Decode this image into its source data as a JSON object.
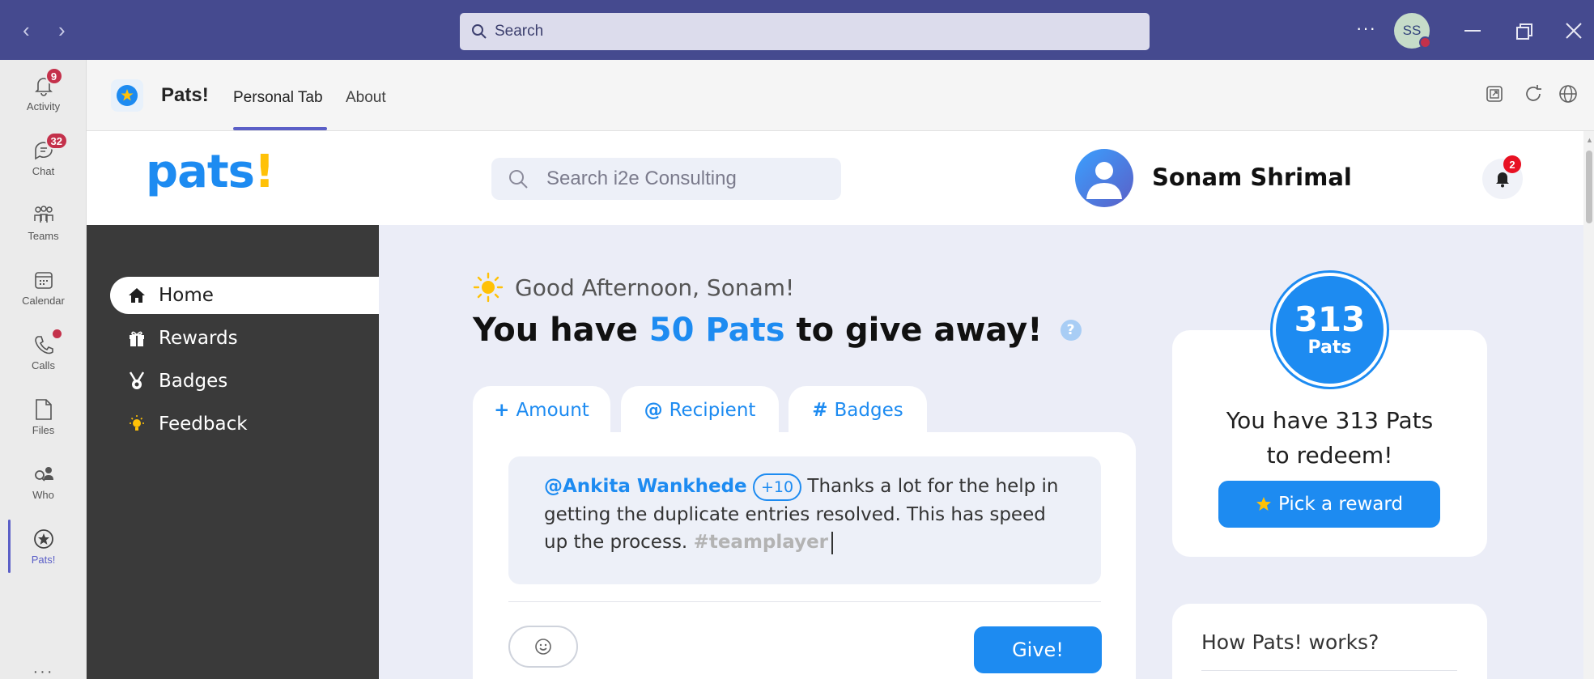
{
  "titlebar": {
    "search_placeholder": "Search",
    "more_label": "···",
    "user_initials": "SS"
  },
  "rail": {
    "items": [
      {
        "label": "Activity",
        "icon": "bell-icon",
        "badge": "9"
      },
      {
        "label": "Chat",
        "icon": "chat-icon",
        "badge": "32"
      },
      {
        "label": "Teams",
        "icon": "teams-icon"
      },
      {
        "label": "Calendar",
        "icon": "calendar-icon"
      },
      {
        "label": "Calls",
        "icon": "phone-icon"
      },
      {
        "label": "Files",
        "icon": "file-icon"
      },
      {
        "label": "Who",
        "icon": "people-icon"
      },
      {
        "label": "Pats!",
        "icon": "pats-star-icon",
        "active": true
      }
    ],
    "more": "···"
  },
  "app_header": {
    "title": "Pats!",
    "tabs": [
      {
        "label": "Personal Tab",
        "active": true
      },
      {
        "label": "About"
      }
    ]
  },
  "pats_header": {
    "logo": "pats!",
    "search_placeholder": "Search i2e Consulting",
    "user_name": "Sonam Shrimal",
    "notification_count": "2"
  },
  "sidenav": {
    "items": [
      {
        "label": "Home",
        "icon": "home-icon",
        "active": true
      },
      {
        "label": "Rewards",
        "icon": "gift-icon"
      },
      {
        "label": "Badges",
        "icon": "medal-icon"
      },
      {
        "label": "Feedback",
        "icon": "lightbulb-icon"
      }
    ]
  },
  "main": {
    "greeting": "Good Afternoon, Sonam!",
    "headline_pre": "You have ",
    "headline_highlight": "50 Pats",
    "headline_post": " to give away!",
    "help": "?",
    "composer_tabs": [
      {
        "symbol": "+",
        "label": "Amount"
      },
      {
        "symbol": "@",
        "label": "Recipient"
      },
      {
        "symbol": "#",
        "label": "Badges"
      }
    ],
    "message": {
      "mention": "@Ankita Wankhede",
      "amount": "+10",
      "text": "Thanks a lot for the help in getting the duplicate entries resolved. This has speed up the process.",
      "hashtag": "#teamplayer"
    },
    "give_label": "Give!"
  },
  "redeem": {
    "count": "313",
    "unit": "Pats",
    "line1": "You have 313 Pats",
    "line2": "to redeem!",
    "button_label": "Pick a reward"
  },
  "how_it_works": {
    "title": "How Pats! works?"
  },
  "colors": {
    "accent": "#1d8bf1",
    "teams_purple": "#454a8f",
    "sidenav": "#3a3a3a",
    "badge_red": "#c4314b",
    "star_yellow": "#ffc107"
  }
}
